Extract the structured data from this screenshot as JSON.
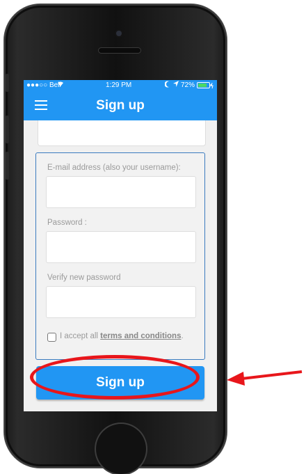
{
  "status_bar": {
    "carrier": "●●●○○ Bell",
    "time": "1:29 PM",
    "battery": "72%"
  },
  "nav": {
    "title": "Sign up"
  },
  "form": {
    "email_label": "E-mail address (also your username):",
    "email_value": "",
    "password_label": "Password :",
    "password_value": "",
    "verify_label": "Verify new password",
    "verify_value": "",
    "terms_prefix": "I accept all ",
    "terms_link": "terms and conditions",
    "terms_suffix": ".",
    "terms_checked": false
  },
  "signup_button": {
    "label": "Sign up"
  },
  "annotation": {
    "highlight_color": "#e8161b"
  },
  "colors": {
    "accent": "#2196f3",
    "form_border": "#3a7bbf"
  }
}
